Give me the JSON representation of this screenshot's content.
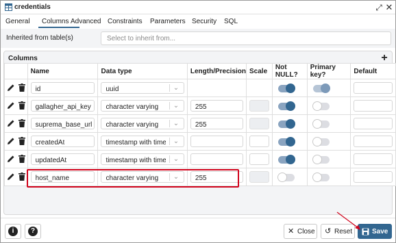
{
  "window": {
    "title": "credentials",
    "expand_icon": "expand-icon",
    "close_icon": "close-icon"
  },
  "tabs": [
    {
      "label": "General",
      "active": false
    },
    {
      "label": "Columns",
      "active": true
    },
    {
      "label": "Advanced",
      "active": false
    },
    {
      "label": "Constraints",
      "active": false
    },
    {
      "label": "Parameters",
      "active": false
    },
    {
      "label": "Security",
      "active": false
    },
    {
      "label": "SQL",
      "active": false
    }
  ],
  "inherit": {
    "label": "Inherited from table(s)",
    "placeholder": "Select to inherit from..."
  },
  "columns_section": {
    "title": "Columns",
    "add_label": "+"
  },
  "grid": {
    "headers": [
      "Name",
      "Data type",
      "Length/Precision",
      "Scale",
      "Not NULL?",
      "Primary key?",
      "Default"
    ],
    "rows": [
      {
        "name": "id",
        "data_type": "uuid",
        "length": "",
        "length_editable": false,
        "scale_editable": false,
        "not_null": true,
        "primary_key": true,
        "pk_disabled": true
      },
      {
        "name": "gallagher_api_key",
        "data_type": "character varying",
        "length": "255",
        "length_editable": true,
        "scale_editable": false,
        "not_null": true,
        "primary_key": false,
        "pk_disabled": false
      },
      {
        "name": "suprema_base_url",
        "data_type": "character varying",
        "length": "255",
        "length_editable": true,
        "scale_editable": false,
        "not_null": true,
        "primary_key": false,
        "pk_disabled": false
      },
      {
        "name": "createdAt",
        "data_type": "timestamp with time z...",
        "length": "",
        "length_editable": true,
        "scale_editable": true,
        "not_null": true,
        "primary_key": false,
        "pk_disabled": false
      },
      {
        "name": "updatedAt",
        "data_type": "timestamp with time z...",
        "length": "",
        "length_editable": true,
        "scale_editable": true,
        "not_null": true,
        "primary_key": false,
        "pk_disabled": false
      },
      {
        "name": "host_name",
        "data_type": "character varying",
        "length": "255",
        "length_editable": true,
        "scale_editable": false,
        "not_null": false,
        "primary_key": false,
        "pk_disabled": false
      }
    ]
  },
  "footer": {
    "info_label": "i",
    "help_label": "?",
    "close_label": "Close",
    "reset_label": "Reset",
    "save_label": "Save"
  },
  "colors": {
    "accent": "#326690",
    "highlight": "#d0021b"
  }
}
